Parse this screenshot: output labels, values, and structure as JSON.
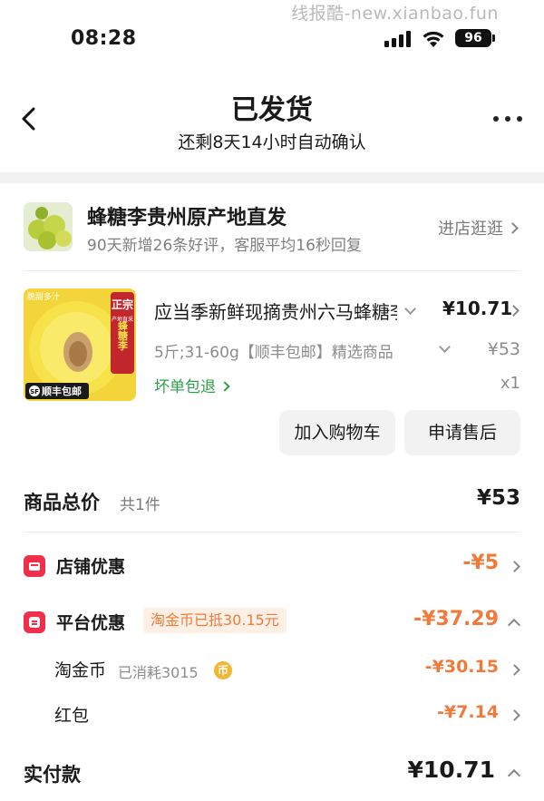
{
  "watermark": "线报酷-new.xianbao.fun",
  "status": {
    "time": "08:28",
    "battery": "96"
  },
  "header": {
    "title": "已发货",
    "subtitle": "还剩8天14小时自动确认"
  },
  "shop": {
    "name": "蜂糖李贵州原产地直发",
    "stats": "90天新增26条好评，客服平均16秒回复",
    "visit_label": "进店逛逛"
  },
  "product": {
    "name": "应当季新鲜现摘贵州六马蜂糖李",
    "price": "¥10.71",
    "spec": "5斤;31-60g【顺丰包邮】精选商品",
    "original_price": "¥53",
    "guarantee": "坏单包退",
    "quantity": "x1",
    "image_badge_top": "正宗",
    "image_badge_text": "蜂糖李",
    "image_badge_small": "产地直采",
    "image_corner": "脆甜多汁",
    "image_shipping": "顺丰包邮",
    "image_shipping_mark": "SF"
  },
  "actions": {
    "add_to_cart": "加入购物车",
    "after_sales": "申请售后"
  },
  "totals": {
    "label": "商品总价",
    "count": "共1件",
    "value": "¥53"
  },
  "discounts": {
    "shop_label": "店铺优惠",
    "shop_value": "-¥5",
    "platform_label": "平台优惠",
    "platform_badge": "淘金币已抵30.15元",
    "platform_value": "-¥37.29",
    "coins_label": "淘金币",
    "coins_note": "已消耗3015",
    "coins_icon": "币",
    "coins_value": "-¥30.15",
    "redpack_label": "红包",
    "redpack_value": "-¥7.14"
  },
  "payment": {
    "label": "实付款",
    "value": "¥10.71"
  }
}
